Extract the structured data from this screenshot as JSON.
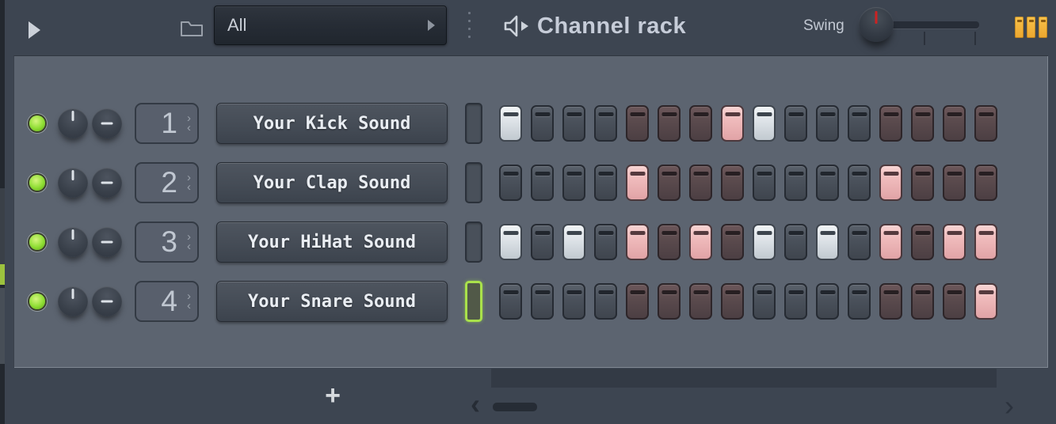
{
  "header": {
    "filter_value": "All",
    "title": "Channel rack",
    "swing_label": "Swing"
  },
  "icons": {
    "spinner_up": "›",
    "spinner_down": "‹",
    "scroll_left": "‹",
    "scroll_right": "›",
    "add": "+"
  },
  "channels": [
    {
      "number": "1",
      "name": "Your Kick Sound",
      "selected": false,
      "steps": [
        1,
        0,
        0,
        0,
        0,
        0,
        0,
        1,
        1,
        0,
        0,
        0,
        0,
        0,
        0,
        0
      ]
    },
    {
      "number": "2",
      "name": "Your Clap Sound",
      "selected": false,
      "steps": [
        0,
        0,
        0,
        0,
        1,
        0,
        0,
        0,
        0,
        0,
        0,
        0,
        1,
        0,
        0,
        0
      ]
    },
    {
      "number": "3",
      "name": "Your HiHat Sound",
      "selected": false,
      "steps": [
        1,
        0,
        1,
        0,
        1,
        0,
        1,
        0,
        1,
        0,
        1,
        0,
        1,
        0,
        1,
        1
      ]
    },
    {
      "number": "4",
      "name": "Your Snare Sound",
      "selected": true,
      "steps": [
        0,
        0,
        0,
        0,
        0,
        0,
        0,
        0,
        0,
        0,
        0,
        0,
        0,
        0,
        0,
        1
      ]
    }
  ],
  "swing": {
    "position_percent": 0
  },
  "steps_per_pattern": 16,
  "colors": {
    "accent_green": "#a9e14b",
    "led_green": "#8edd33",
    "step_lit_light": "#dfe4e9",
    "step_lit_pink": "#efbabb",
    "step_unlit_gray": "#4a515b",
    "step_unlit_maroon": "#5a4a4d",
    "orange_icon": "#f2b23c",
    "swing_indicator_red": "#cc2222",
    "panel_bg": "#5c6470",
    "window_bg": "#3d4551"
  }
}
